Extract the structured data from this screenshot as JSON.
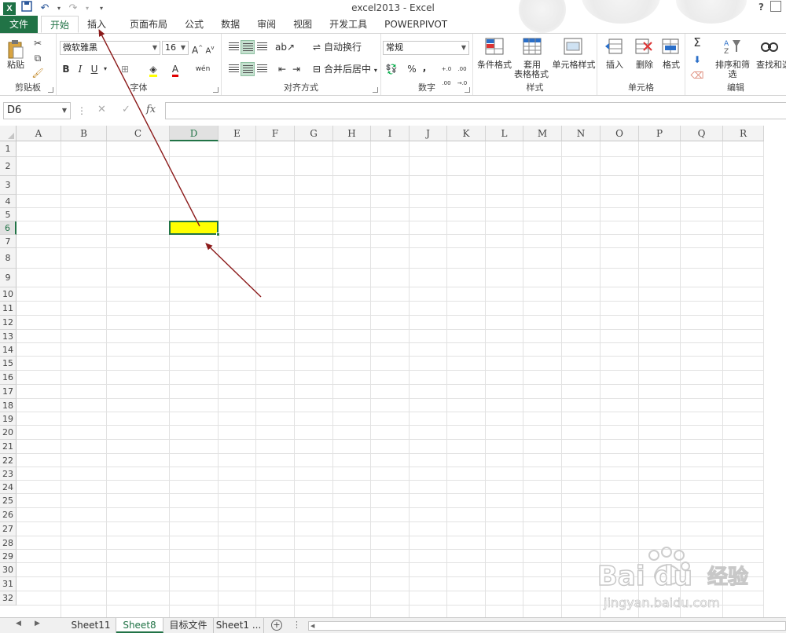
{
  "window": {
    "title": "excel2013 - Excel",
    "help": "?"
  },
  "qat": {
    "logo": "X",
    "save_icon": "floppy-disk-icon",
    "undo_icon": "undo-icon",
    "redo_icon": "redo-icon",
    "customize_icon": "dropdown-icon"
  },
  "tabs": [
    {
      "label": "文件"
    },
    {
      "label": "开始"
    },
    {
      "label": "插入"
    },
    {
      "label": "页面布局"
    },
    {
      "label": "公式"
    },
    {
      "label": "数据"
    },
    {
      "label": "审阅"
    },
    {
      "label": "视图"
    },
    {
      "label": "开发工具"
    },
    {
      "label": "POWERPIVOT"
    }
  ],
  "ribbon": {
    "clipboard": {
      "label": "剪贴板",
      "paste": "粘贴"
    },
    "font": {
      "label": "字体",
      "name": "微软雅黑",
      "size": "16",
      "bold": "B",
      "italic": "I",
      "underline": "U",
      "grow": "A",
      "shrink": "A",
      "font_color_letter": "A",
      "phonetic": "wén"
    },
    "alignment": {
      "label": "对齐方式",
      "wrap_text": "自动换行",
      "merge_center": "合并后居中"
    },
    "number": {
      "label": "数字",
      "format": "常规",
      "percent": "%",
      "comma": ",",
      "inc_dec": "+.0 .00",
      "dec_dec": ".00 →.0"
    },
    "styles": {
      "label": "样式",
      "conditional": "条件格式",
      "table_1": "套用",
      "table_2": "表格格式",
      "cell_styles": "单元格样式"
    },
    "cells": {
      "label": "单元格",
      "insert": "插入",
      "delete": "删除",
      "format": "格式"
    },
    "editing": {
      "label": "编辑",
      "sum": "Σ",
      "sort_filter": "排序和筛选",
      "find_select": "查找和选"
    }
  },
  "formula_bar": {
    "name_box": "D6",
    "cancel": "✕",
    "enter": "✓",
    "fx": "fx",
    "value": ""
  },
  "grid": {
    "columns": [
      "A",
      "B",
      "C",
      "D",
      "E",
      "F",
      "G",
      "H",
      "I",
      "J",
      "K",
      "L",
      "M",
      "N",
      "O",
      "P",
      "Q",
      "R"
    ],
    "rows": [
      "1",
      "2",
      "3",
      "4",
      "5",
      "6",
      "7",
      "8",
      "9",
      "10",
      "11",
      "12",
      "13",
      "14",
      "15",
      "16",
      "17",
      "18",
      "19",
      "20",
      "21",
      "22",
      "23",
      "24",
      "25",
      "26",
      "27",
      "28",
      "29",
      "30",
      "31",
      "32"
    ],
    "selected_col": "D",
    "selected_row": "6",
    "selected_fill": "#ffff00"
  },
  "sheets": {
    "tabs": [
      "Sheet11",
      "Sheet8",
      "目标文件",
      "Sheet1 ..."
    ],
    "active": "Sheet8"
  },
  "colors": {
    "accent": "#217346",
    "arrow": "#8b1a1a"
  },
  "watermark": {
    "text_logo": "Bai du",
    "text_cn": "经验",
    "url": "jingyan.baidu.com"
  }
}
